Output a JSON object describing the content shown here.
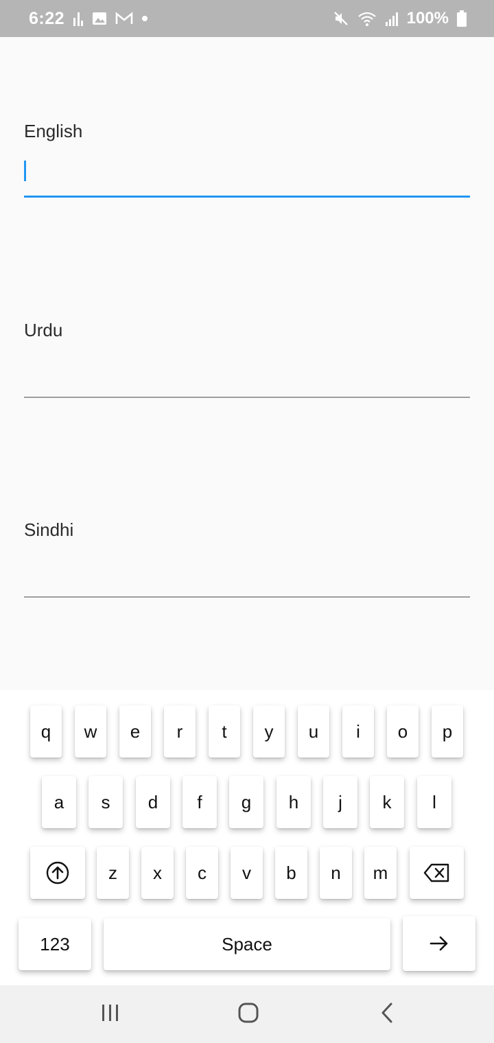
{
  "status_bar": {
    "time": "6:22",
    "battery": "100%",
    "left_icons": [
      "signal-bars-icon",
      "image-icon",
      "gmail-icon",
      "dot-icon"
    ],
    "right_icons": [
      "mute-icon",
      "wifi-icon",
      "cell-signal-icon",
      "battery-icon"
    ]
  },
  "form": {
    "fields": [
      {
        "label": "English",
        "value": "",
        "focused": true
      },
      {
        "label": "Urdu",
        "value": "",
        "focused": false
      },
      {
        "label": "Sindhi",
        "value": "",
        "focused": false
      }
    ],
    "accent_color": "#2196f3"
  },
  "keyboard": {
    "row1": [
      "q",
      "w",
      "e",
      "r",
      "t",
      "y",
      "u",
      "i",
      "o",
      "p"
    ],
    "row2": [
      "a",
      "s",
      "d",
      "f",
      "g",
      "h",
      "j",
      "k",
      "l"
    ],
    "row3": [
      "z",
      "x",
      "c",
      "v",
      "b",
      "n",
      "m"
    ],
    "shift_icon": "shift-icon",
    "backspace_icon": "backspace-icon",
    "symbols_label": "123",
    "space_label": "Space",
    "enter_icon": "arrow-right-icon"
  },
  "nav_bar": {
    "buttons": [
      "recent-apps-icon",
      "home-icon",
      "back-icon"
    ]
  }
}
